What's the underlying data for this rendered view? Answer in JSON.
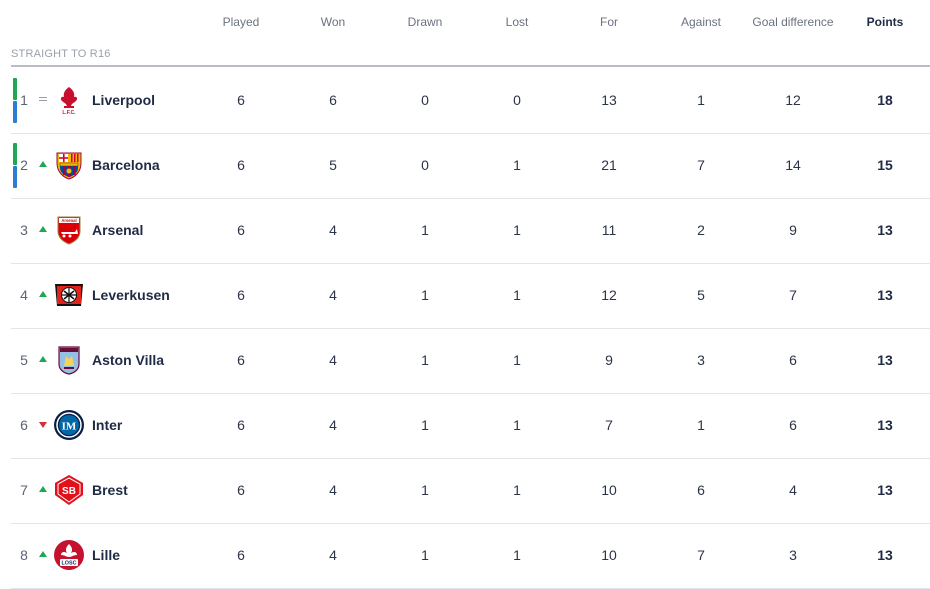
{
  "columns": {
    "played": "Played",
    "won": "Won",
    "drawn": "Drawn",
    "lost": "Lost",
    "for": "For",
    "against": "Against",
    "goal_difference": "Goal difference",
    "points": "Points"
  },
  "section": {
    "label": "STRAIGHT TO R16"
  },
  "colors": {
    "qualification_green": "#1ea853",
    "qualification_blue": "#2a7fd2",
    "up": "#1ea853",
    "down": "#d0303c"
  },
  "rows": [
    {
      "position": "1",
      "movement": "same",
      "team": "Liverpool",
      "crest_icon": "liverpool-crest-icon",
      "crest_text": "L.F.C.",
      "played": "6",
      "won": "6",
      "drawn": "0",
      "lost": "0",
      "for": "13",
      "against": "1",
      "goal_difference": "12",
      "points": "18",
      "qualification": "split"
    },
    {
      "position": "2",
      "movement": "up",
      "team": "Barcelona",
      "crest_icon": "barcelona-crest-icon",
      "played": "6",
      "won": "5",
      "drawn": "0",
      "lost": "1",
      "for": "21",
      "against": "7",
      "goal_difference": "14",
      "points": "15",
      "qualification": "split"
    },
    {
      "position": "3",
      "movement": "up",
      "team": "Arsenal",
      "crest_icon": "arsenal-crest-icon",
      "crest_text": "Arsenal",
      "played": "6",
      "won": "4",
      "drawn": "1",
      "lost": "1",
      "for": "11",
      "against": "2",
      "goal_difference": "9",
      "points": "13"
    },
    {
      "position": "4",
      "movement": "up",
      "team": "Leverkusen",
      "crest_icon": "leverkusen-crest-icon",
      "played": "6",
      "won": "4",
      "drawn": "1",
      "lost": "1",
      "for": "12",
      "against": "5",
      "goal_difference": "7",
      "points": "13"
    },
    {
      "position": "5",
      "movement": "up",
      "team": "Aston Villa",
      "crest_icon": "aston-villa-crest-icon",
      "played": "6",
      "won": "4",
      "drawn": "1",
      "lost": "1",
      "for": "9",
      "against": "3",
      "goal_difference": "6",
      "points": "13"
    },
    {
      "position": "6",
      "movement": "down",
      "team": "Inter",
      "crest_icon": "inter-crest-icon",
      "crest_text": "IM",
      "played": "6",
      "won": "4",
      "drawn": "1",
      "lost": "1",
      "for": "7",
      "against": "1",
      "goal_difference": "6",
      "points": "13"
    },
    {
      "position": "7",
      "movement": "up",
      "team": "Brest",
      "crest_icon": "brest-crest-icon",
      "crest_text": "SB",
      "played": "6",
      "won": "4",
      "drawn": "1",
      "lost": "1",
      "for": "10",
      "against": "6",
      "goal_difference": "4",
      "points": "13"
    },
    {
      "position": "8",
      "movement": "up",
      "team": "Lille",
      "crest_icon": "lille-crest-icon",
      "crest_text": "LOSC",
      "played": "6",
      "won": "4",
      "drawn": "1",
      "lost": "1",
      "for": "10",
      "against": "7",
      "goal_difference": "3",
      "points": "13"
    }
  ]
}
